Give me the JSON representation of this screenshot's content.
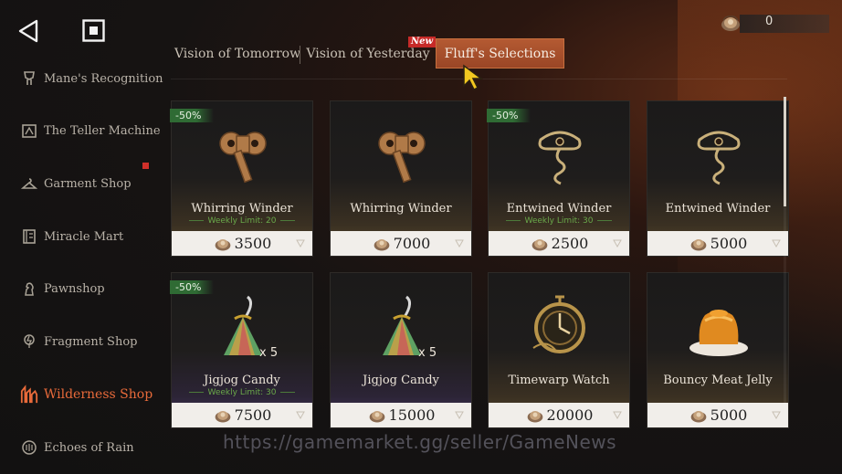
{
  "currency": {
    "value": "0"
  },
  "sidebar": {
    "items": [
      {
        "label": "Mane's Recognition",
        "icon": "mane-recognition-icon"
      },
      {
        "label": "The Teller Machine",
        "icon": "teller-machine-icon"
      },
      {
        "label": "Garment Shop",
        "icon": "hanger-icon"
      },
      {
        "label": "Miracle Mart",
        "icon": "mart-icon"
      },
      {
        "label": "Pawnshop",
        "icon": "pawnshop-icon"
      },
      {
        "label": "Fragment Shop",
        "icon": "fragment-icon"
      },
      {
        "label": "Wilderness Shop",
        "icon": "wilderness-icon"
      },
      {
        "label": "Echoes of Rain",
        "icon": "rain-icon"
      }
    ],
    "active_index": 6
  },
  "tabs": {
    "items": [
      {
        "label": "Vision of Tomorrow"
      },
      {
        "label": "Vision of Yesterday"
      },
      {
        "label": "Fluff's Selections"
      }
    ],
    "active_index": 2,
    "new_badge": "New"
  },
  "shop": {
    "items": [
      {
        "name": "Whirring Winder",
        "discount": "-50%",
        "limit": "Weekly Limit: 20",
        "price": "3500",
        "qty": "",
        "art": "winder-key"
      },
      {
        "name": "Whirring Winder",
        "discount": "",
        "limit": "",
        "price": "7000",
        "qty": "",
        "art": "winder-key"
      },
      {
        "name": "Entwined Winder",
        "discount": "-50%",
        "limit": "Weekly Limit: 30",
        "price": "2500",
        "qty": "",
        "art": "entwined-winder"
      },
      {
        "name": "Entwined Winder",
        "discount": "",
        "limit": "",
        "price": "5000",
        "qty": "",
        "art": "entwined-winder"
      },
      {
        "name": "Jigjog Candy",
        "discount": "-50%",
        "limit": "Weekly Limit: 30",
        "price": "7500",
        "qty": "x 5",
        "art": "candy"
      },
      {
        "name": "Jigjog Candy",
        "discount": "",
        "limit": "",
        "price": "15000",
        "qty": "x 5",
        "art": "candy"
      },
      {
        "name": "Timewarp Watch",
        "discount": "",
        "limit": "",
        "price": "20000",
        "qty": "",
        "art": "watch"
      },
      {
        "name": "Bouncy Meat Jelly",
        "discount": "",
        "limit": "",
        "price": "5000",
        "qty": "",
        "art": "jelly"
      }
    ]
  },
  "watermark": "https://gamemarket.gg/seller/GameNews",
  "colors": {
    "accent": "#e86a3a",
    "tab_active": "#a84e2a",
    "discount": "#2f6b34",
    "limit_text": "#6aa84a"
  }
}
